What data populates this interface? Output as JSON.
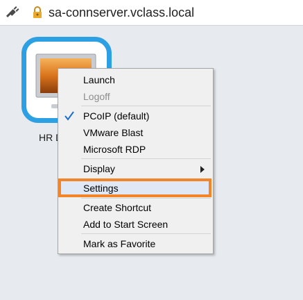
{
  "connection": {
    "server_name": "sa-connserver.vclass.local",
    "plug_icon": "plug-icon",
    "lock_icon": "lock-icon"
  },
  "desktop": {
    "label": "HR D",
    "icon": "monitor-icon"
  },
  "context_menu": {
    "items": [
      {
        "label": "Launch",
        "enabled": true
      },
      {
        "label": "Logoff",
        "enabled": false
      },
      {
        "label": "PCoIP (default)",
        "checked": true
      },
      {
        "label": "VMware Blast"
      },
      {
        "label": "Microsoft RDP"
      },
      {
        "label": "Display",
        "submenu": true
      },
      {
        "label": "Settings",
        "highlighted": true
      },
      {
        "label": "Create Shortcut"
      },
      {
        "label": "Add to Start Screen"
      },
      {
        "label": "Mark as Favorite"
      }
    ],
    "highlight_color": "#f48428",
    "check_icon": "check-icon",
    "submenu_icon": "chevron-right-icon"
  },
  "colors": {
    "tile_border": "#2d9fe3",
    "background": "#e7ebef",
    "check_mark": "#1c6dd0"
  }
}
